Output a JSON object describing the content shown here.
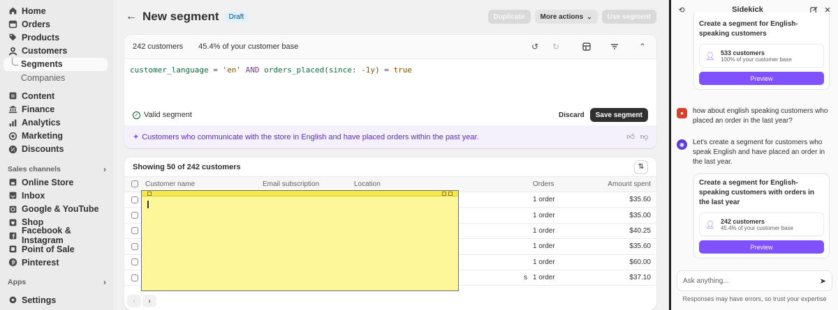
{
  "sidebar": {
    "items": [
      {
        "label": "Home",
        "icon": "home-icon"
      },
      {
        "label": "Orders",
        "icon": "orders-icon"
      },
      {
        "label": "Products",
        "icon": "tag-icon"
      },
      {
        "label": "Customers",
        "icon": "person-icon"
      }
    ],
    "sub_items": [
      {
        "label": "Segments",
        "active": true
      },
      {
        "label": "Companies",
        "active": false
      }
    ],
    "items2": [
      {
        "label": "Content",
        "icon": "content-icon"
      },
      {
        "label": "Finance",
        "icon": "bank-icon"
      },
      {
        "label": "Analytics",
        "icon": "chart-icon"
      },
      {
        "label": "Marketing",
        "icon": "target-icon"
      },
      {
        "label": "Discounts",
        "icon": "discount-icon"
      }
    ],
    "sales_channels_label": "Sales channels",
    "channels": [
      {
        "label": "Online Store"
      },
      {
        "label": "Inbox"
      },
      {
        "label": "Google & YouTube"
      },
      {
        "label": "Shop"
      },
      {
        "label": "Facebook & Instagram"
      },
      {
        "label": "Point of Sale"
      },
      {
        "label": "Pinterest"
      }
    ],
    "apps_label": "Apps",
    "settings_label": "Settings"
  },
  "header": {
    "title": "New segment",
    "badge": "Draft",
    "duplicate": "Duplicate",
    "more_actions": "More actions",
    "use_segment": "Use segment"
  },
  "editor": {
    "customer_count": "242",
    "customers_word": "customers",
    "pct": "45.4%",
    "pct_suffix": "of your customer base",
    "code": {
      "field1": "customer_language",
      "eq1": " = ",
      "str1": "'en'",
      "and": " AND ",
      "field2": "orders_placed",
      "p_open": "(",
      "param": "since",
      "colon": ": ",
      "val": "-1y",
      "p_close": ")",
      "eq2": " = ",
      "bool": "true"
    },
    "valid_text": "Valid segment",
    "discard": "Discard",
    "save": "Save segment",
    "ai_summary": "Customers who communicate with the store in English and have placed orders within the past year."
  },
  "table": {
    "showing": "Showing 50 of 242 customers",
    "headers": [
      "Customer name",
      "Email subscription",
      "Location",
      "Orders",
      "Amount spent"
    ],
    "rows": [
      {
        "orders": "1 order",
        "amount": "$35.60"
      },
      {
        "orders": "1 order",
        "amount": "$35.00"
      },
      {
        "orders": "1 order",
        "amount": "$40.25"
      },
      {
        "orders": "1 order",
        "amount": "$35.60"
      },
      {
        "orders": "1 order",
        "amount": "$60.00"
      },
      {
        "orders": "1 order",
        "amount": "$37.10"
      }
    ],
    "row_fragment": "s"
  },
  "sidekick": {
    "title": "Sidekick",
    "card1": {
      "title": "Create a segment for English-speaking customers",
      "stat1": "533 customers",
      "stat2": "100% of your customer base",
      "preview": "Preview"
    },
    "user_msg": "how about english speaking customers who placed an order in the last year?",
    "bot_msg": "Let's create a segment for customers who speak English and have placed an order in the last year.",
    "card2": {
      "title": "Create a segment for English-speaking customers with orders in the last year",
      "stat1": "242 customers",
      "stat2": "45.4% of your customer base",
      "preview": "Preview"
    },
    "input_placeholder": "Ask anything...",
    "disclaimer": "Responses may have errors, so trust your expertise"
  },
  "colors": {
    "accent": "#8051ff",
    "sticky": "#fdf79a",
    "primary_dark": "#303030"
  }
}
